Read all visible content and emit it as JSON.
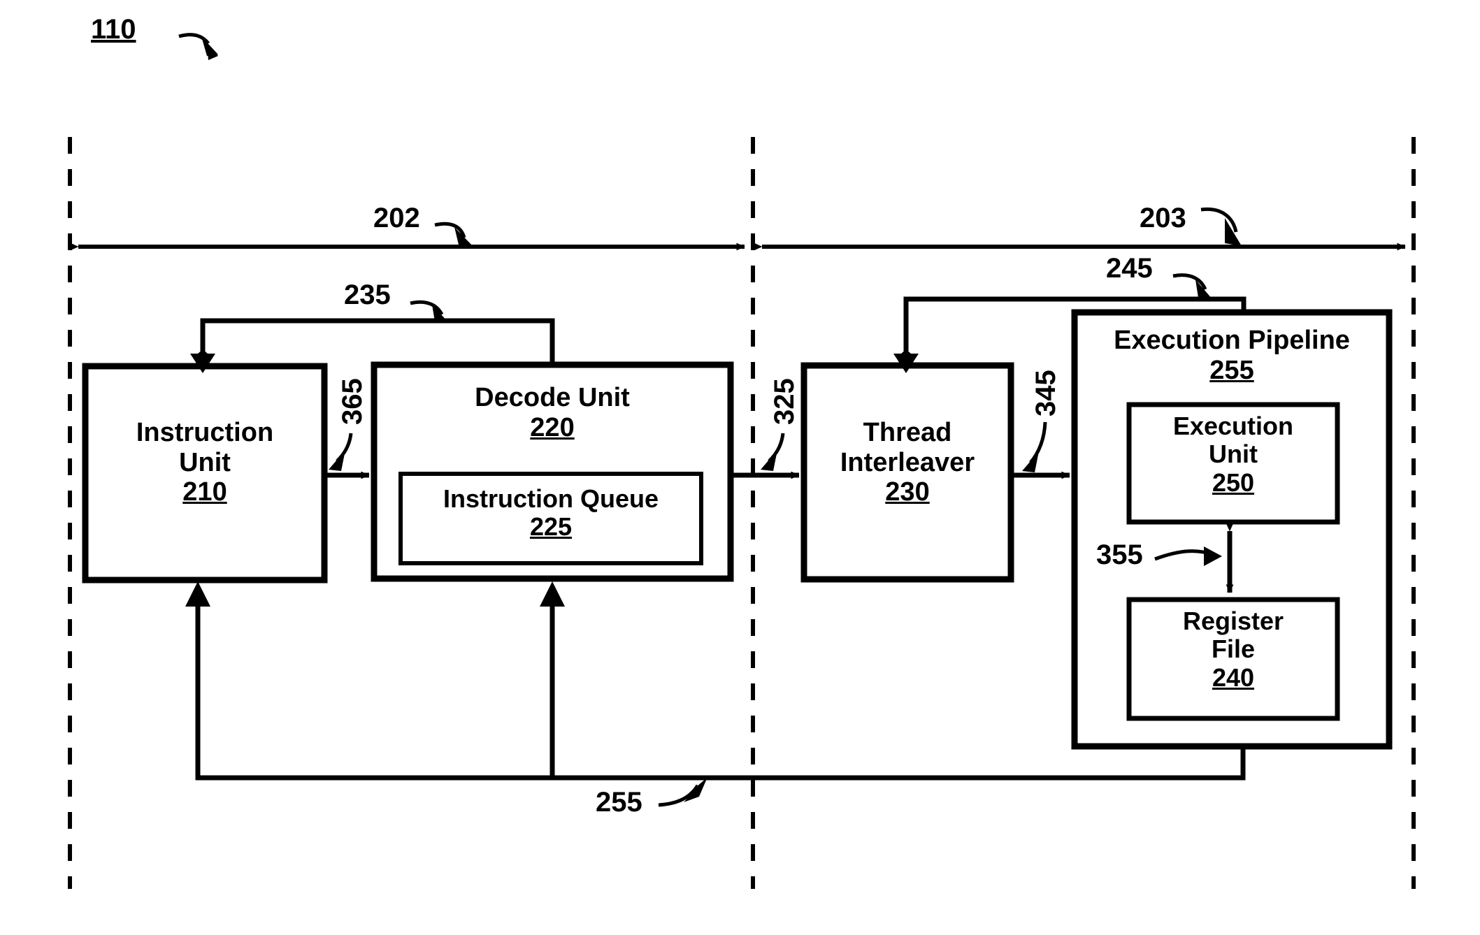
{
  "figure": {
    "figure_number": "110",
    "stage_labels": {
      "front_end": "202",
      "back_end": "203"
    },
    "blocks": [
      {
        "id": "instruction-unit",
        "title": "Instruction\nUnit",
        "line1": "Instruction",
        "line2": "Unit",
        "number": "210"
      },
      {
        "id": "decode-unit",
        "line1": "Decode Unit",
        "number": "220"
      },
      {
        "id": "instruction-queue",
        "line1": "Instruction Queue",
        "number": "225"
      },
      {
        "id": "thread-interleaver",
        "line1": "Thread",
        "line2": "Interleaver",
        "number": "230"
      },
      {
        "id": "execution-pipeline",
        "line1": "Execution Pipeline",
        "number": "255"
      },
      {
        "id": "execution-unit",
        "line1": "Execution",
        "line2": "Unit",
        "number": "250"
      },
      {
        "id": "register-file",
        "line1": "Register",
        "line2": "File",
        "number": "240"
      }
    ],
    "signals": [
      {
        "id": "decode-to-instruction-feedback",
        "label": "235"
      },
      {
        "id": "instruction-to-decode",
        "label": "365"
      },
      {
        "id": "decode-to-interleaver",
        "label": "325"
      },
      {
        "id": "interleaver-to-pipeline",
        "label": "345"
      },
      {
        "id": "pipeline-to-interleaver-feedback",
        "label": "245"
      },
      {
        "id": "execution-register-bidirectional",
        "label": "355"
      },
      {
        "id": "pipeline-writeback",
        "label": "255"
      }
    ],
    "colors": {
      "stroke": "#000000",
      "background": "#ffffff"
    }
  }
}
